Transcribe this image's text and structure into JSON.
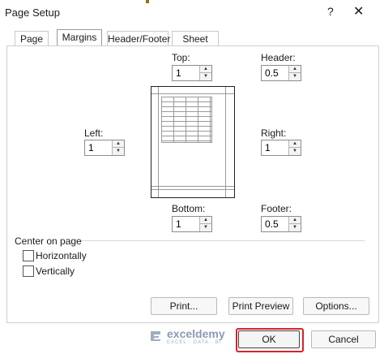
{
  "window": {
    "title": "Page Setup",
    "help": "?",
    "close": "✕"
  },
  "tabs": [
    {
      "label": "Page"
    },
    {
      "label": "Margins"
    },
    {
      "label": "Header/Footer"
    },
    {
      "label": "Sheet"
    }
  ],
  "margins": {
    "top": {
      "label": "Top:",
      "value": "1"
    },
    "header": {
      "label": "Header:",
      "value": "0.5"
    },
    "left": {
      "label": "Left:",
      "value": "1"
    },
    "right": {
      "label": "Right:",
      "value": "1"
    },
    "bottom": {
      "label": "Bottom:",
      "value": "1"
    },
    "footer": {
      "label": "Footer:",
      "value": "0.5"
    }
  },
  "center_on_page": {
    "label": "Center on page",
    "horizontally": {
      "label": "Horizontally",
      "checked": false
    },
    "vertically": {
      "label": "Vertically",
      "checked": false
    }
  },
  "buttons": {
    "print": "Print...",
    "print_preview": "Print Preview",
    "options": "Options...",
    "ok": "OK",
    "cancel": "Cancel"
  },
  "watermark": {
    "name": "exceldemy",
    "tagline": "EXCEL · DATA · BI"
  },
  "colors": {
    "highlight": "#d8232a"
  }
}
